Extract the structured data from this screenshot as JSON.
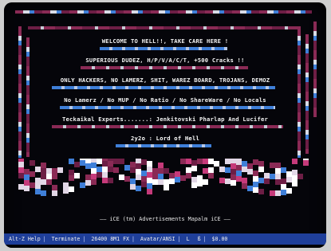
{
  "screen": {
    "lines": [
      "WELCOME TO HELL!!, TAKE CARE HERE !",
      "SUPERIOUS DUDEZ, H/P/V/A/C/T, +500 Cracks !!",
      "ONLY HACKERS, NO LAMERZ, SHIT, WAREZ BOARD, TROJANS, DEMOZ",
      "No Lamerz / No MUP / No Ratio / No ShareWare / No Locals",
      "Teckaikal Experts.......:  Jenkitovski Pharlap  And  Lucifer",
      "2y2o : Lord of Hell"
    ]
  },
  "ad_line": "—— iCE (tm) Advertisements  Mapalm  iCE ——",
  "statusbar": {
    "items": [
      "Alt-Z Help",
      "Terminate",
      "26400 8M1 FX",
      "Avatar/ANSI",
      "L",
      "ß",
      "$0.00"
    ]
  },
  "colors": {
    "background": "#05050a",
    "status_bg": "#1f3f9a",
    "accent_maroon": "#8a2a55",
    "accent_blue": "#3f7fd8"
  }
}
